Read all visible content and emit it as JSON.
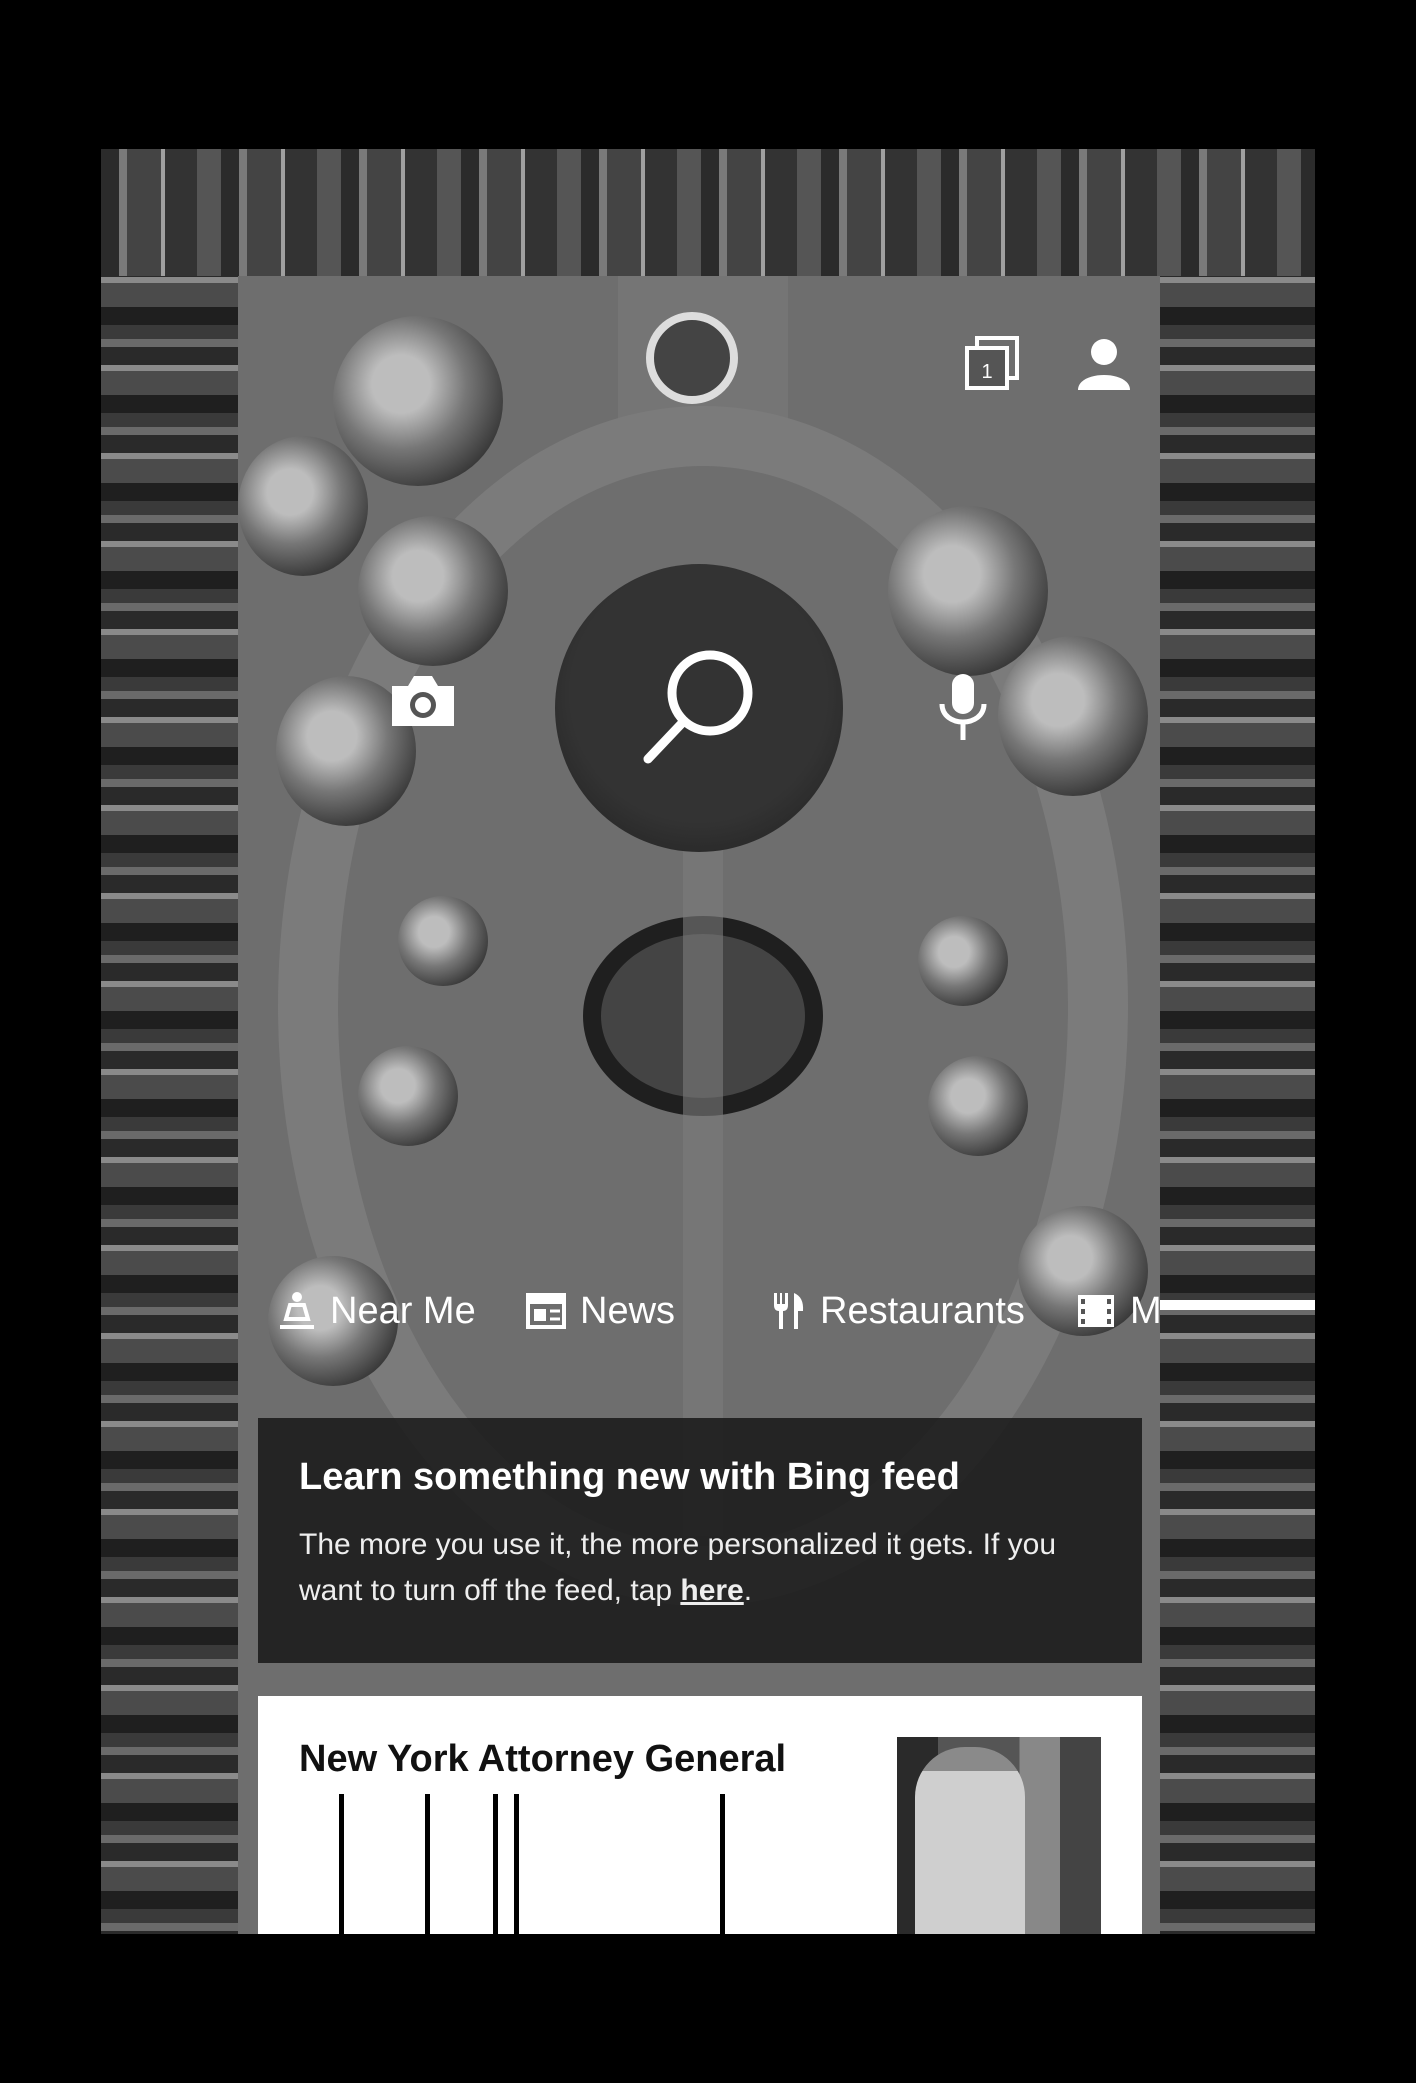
{
  "header": {
    "tabs_icon": "tabs-icon",
    "tabs_count": "1",
    "profile_icon": "profile-icon"
  },
  "search": {
    "search_icon": "search-icon",
    "camera_icon": "camera-icon",
    "mic_icon": "microphone-icon"
  },
  "chips": [
    {
      "label": "Near Me",
      "icon": "near-me-icon"
    },
    {
      "label": "News",
      "icon": "news-icon"
    },
    {
      "label": "Restaurants",
      "icon": "restaurant-icon"
    },
    {
      "label": "Mov",
      "icon": "movies-icon"
    }
  ],
  "promo": {
    "title": "Learn something new with Bing feed",
    "body_prefix": "The more you use it, the more personalized it gets. If you want to turn off the feed, tap ",
    "link": "here",
    "body_suffix": "."
  },
  "news_card": {
    "title": "New York Attorney General"
  },
  "colors": {
    "background": "#000000",
    "card": "#ffffff",
    "text_light": "#ffffff",
    "text_dark": "#111111"
  }
}
